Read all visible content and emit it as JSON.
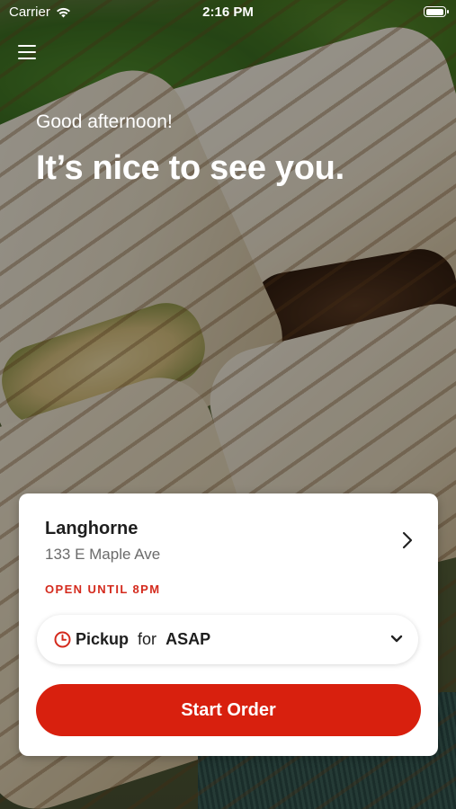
{
  "status_bar": {
    "carrier": "Carrier",
    "time": "2:16 PM",
    "battery_level": 1.0
  },
  "header": {
    "menu_icon": "hamburger-menu-icon",
    "greeting": "Good afternoon!",
    "headline": "It’s nice to see you."
  },
  "location_card": {
    "store_name": "Langhorne",
    "address": "133 E Maple Ave",
    "hours_status": "OPEN UNTIL 8PM",
    "order_type": {
      "method": "Pickup",
      "connector": "for",
      "time": "ASAP",
      "icon": "clock-icon"
    },
    "start_button": "Start Order"
  },
  "colors": {
    "accent": "#d8200e",
    "hours_text": "#d42a1d",
    "card_bg": "#ffffff"
  }
}
